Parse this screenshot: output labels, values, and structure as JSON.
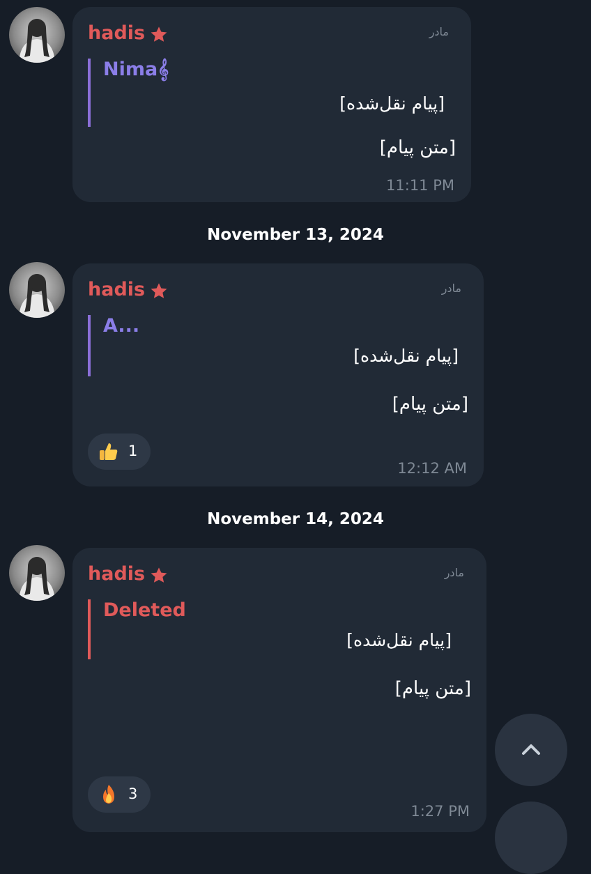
{
  "messages": [
    {
      "sender": "hadis",
      "role": "مادر",
      "quote_author": "Nima𝄞",
      "quote_text": "[پیام نقل‌شده]",
      "text": "[متن پیام]",
      "time": "11:11 PM"
    },
    {
      "sender": "hadis",
      "role": "مادر",
      "quote_author": "A...",
      "quote_text": "[پیام نقل‌شده]",
      "text": "[متن پیام]",
      "reaction": {
        "emoji": "thumbs-up",
        "count": "1"
      },
      "time": "12:12 AM"
    },
    {
      "sender": "hadis",
      "role": "مادر",
      "quote_author": "Deleted",
      "quote_text": "[پیام نقل‌شده]",
      "text": "[متن پیام]",
      "reaction": {
        "emoji": "fire",
        "count": "3"
      },
      "time": "1:27 PM"
    }
  ],
  "dates": [
    "November 13, 2024",
    "November 14, 2024"
  ],
  "colors": {
    "background": "#161d27",
    "bubble": "#212a36",
    "sender": "#e05a5a",
    "quote_bar_purple": "#8b6fd8",
    "quote_bar_red": "#e05a5a",
    "quote_name_purple": "#8b7ee8",
    "quote_name_red": "#e05a5a",
    "meta_text": "#7f8995"
  }
}
